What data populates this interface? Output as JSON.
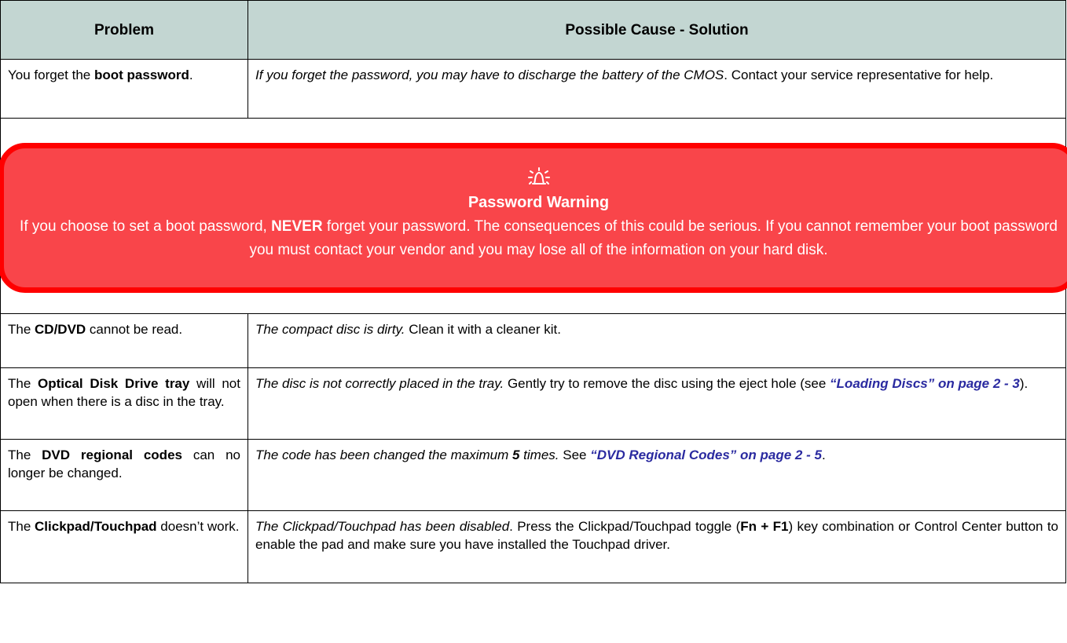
{
  "table": {
    "header": {
      "problem": "Problem",
      "solution": "Possible Cause - Solution"
    },
    "rows": [
      {
        "problem": {
          "t1": "You forget the ",
          "b1": "boot password",
          "t2": "."
        },
        "solution": {
          "i1": "If you forget the password, you may have to discharge the battery of the CMOS",
          "t1": ". Contact your service representative for help."
        }
      },
      {
        "problem": {
          "t1": "The ",
          "b1": "CD/DVD",
          "t2": " cannot be read."
        },
        "solution": {
          "i1": "The compact disc is dirty.",
          "t1": " Clean it with a cleaner kit."
        }
      },
      {
        "problem": {
          "t1": "The ",
          "b1": "Optical Disk Drive tray",
          "t2": " will not open when there is a disc in the tray."
        },
        "solution": {
          "i1": "The disc is not correctly placed in the tray.",
          "t1": " Gently try to remove the disc using the eject hole (see ",
          "link": "“Loading Discs” on page 2 - 3",
          "t2": ")."
        }
      },
      {
        "problem": {
          "t1": "The ",
          "b1": "DVD regional codes",
          "t2": " can no longer be changed."
        },
        "solution": {
          "i1": "The code has been changed the maximum ",
          "bi": "5",
          "i2": " times.",
          "t1": " See ",
          "link": "“DVD Regional Codes” on page 2 - 5",
          "t2": "."
        }
      },
      {
        "problem": {
          "t1": "The ",
          "b1": "Clickpad/Touchpad",
          "t2": " doesn’t work."
        },
        "solution": {
          "i1": "The Clickpad/Touchpad has been disabled",
          "t1": ". Press the Clickpad/Touchpad toggle (",
          "b1": "Fn + F1",
          "t2": ") key combination or Control Center button to enable the pad and make sure you have installed the Touchpad driver."
        }
      }
    ]
  },
  "warning": {
    "icon": "alarm-bell-icon",
    "title": "Password Warning",
    "t1": "If you choose to set a boot password, ",
    "b1": "NEVER",
    "t2": " forget your password. The consequences of this could be serious. If you cannot remember your boot password you must contact your vendor and you may lose all of the information on your hard disk.",
    "colors": {
      "fill": "#f9454a",
      "border": "#ff0000",
      "header": "#c3d6d2",
      "link": "#2a2aa0"
    }
  }
}
